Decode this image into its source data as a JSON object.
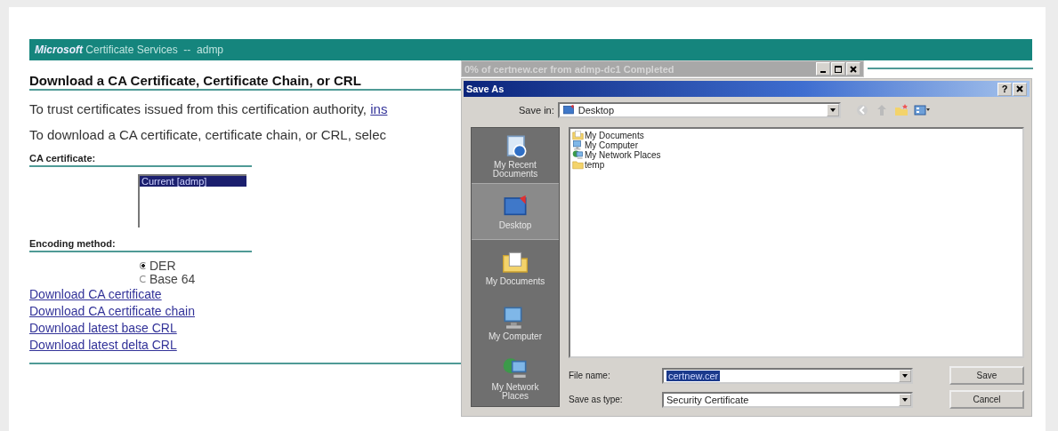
{
  "banner": {
    "brand": "Microsoft",
    "title": "Certificate Services  --  admp"
  },
  "heading": "Download a CA Certificate, Certificate Chain, or CRL",
  "intro": {
    "text": "To trust certificates issued from this certification authority, ",
    "link": "ins"
  },
  "instruction": "To download a CA certificate, certificate chain, or CRL, selec",
  "ca_certificate": {
    "label": "CA certificate:",
    "items": [
      {
        "text": "Current [admp]",
        "selected": true
      }
    ]
  },
  "encoding": {
    "label": "Encoding method:",
    "options": [
      {
        "label": "DER",
        "selected": true
      },
      {
        "label": "Base 64",
        "selected": false
      }
    ]
  },
  "links": [
    "Download CA certificate",
    "Download CA certificate chain",
    "Download latest base CRL",
    "Download latest delta CRL"
  ],
  "progress_window": {
    "title": "0% of certnew.cer from admp-dc1 Completed"
  },
  "save_dialog": {
    "title": "Save As",
    "help": "?",
    "save_in_label": "Save in:",
    "save_in": "Desktop",
    "places": [
      {
        "label": "My Recent Documents",
        "kind": "recent",
        "selected": false
      },
      {
        "label": "Desktop",
        "kind": "desktop",
        "selected": true
      },
      {
        "label": "My Documents",
        "kind": "documents",
        "selected": false
      },
      {
        "label": "My Computer",
        "kind": "computer",
        "selected": false
      },
      {
        "label": "My Network Places",
        "kind": "network",
        "selected": false
      }
    ],
    "files": [
      {
        "name": "My Documents",
        "kind": "documents"
      },
      {
        "name": "My Computer",
        "kind": "computer"
      },
      {
        "name": "My Network Places",
        "kind": "network"
      },
      {
        "name": "temp",
        "kind": "folder"
      }
    ],
    "file_name_label": "File name:",
    "file_name": "certnew.cer",
    "type_label": "Save as type:",
    "type": "Security Certificate",
    "buttons": [
      "Save",
      "Cancel"
    ]
  }
}
